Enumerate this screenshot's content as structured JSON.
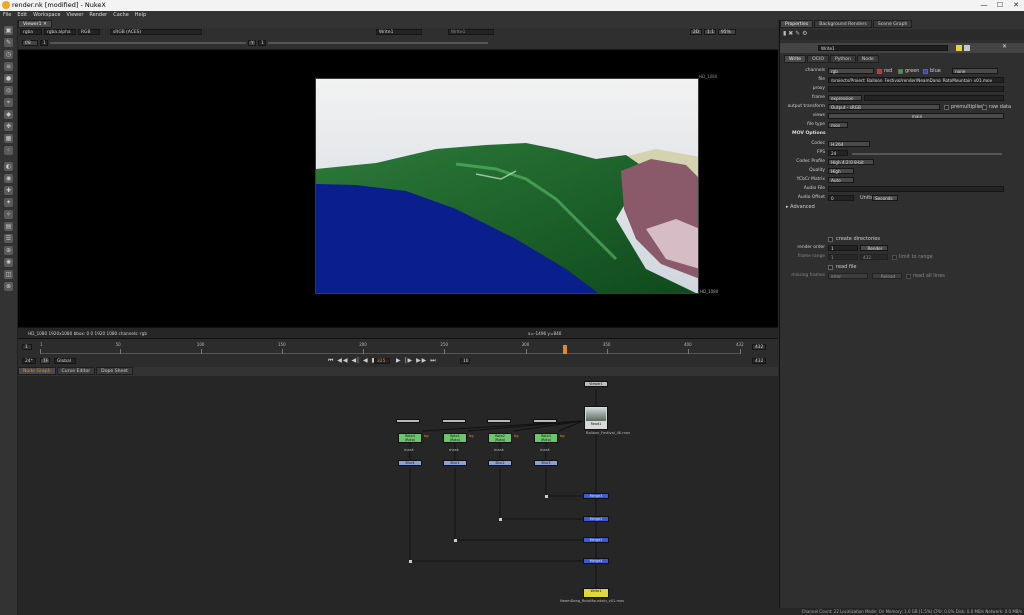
{
  "window": {
    "title": "render.nk [modified] - NukeX",
    "min": "—",
    "max": "☐",
    "close": "✕"
  },
  "menu": [
    "File",
    "Edit",
    "Workspace",
    "Viewer",
    "Render",
    "Cache",
    "Help"
  ],
  "viewer": {
    "tab": "Viewer1",
    "channels": "rgba",
    "alpha": "rgba.alpha",
    "colorspace_label": "RGB",
    "y_label": "sRGB (ACES)",
    "input_a": "Write1",
    "input_b": "Write1",
    "gain_label": "f/8",
    "gain_value": "1",
    "gamma_label": "Y",
    "gamma_value": "1",
    "frame_mode": "2D",
    "fps_ratio": "1:1",
    "zoom": "95%",
    "format_top": "HD_1080",
    "format_bottom": "HD_1080",
    "info_left": "HD_1080 1920x1080  bbox: 0 0 1920 1080 channels: rgb",
    "info_right": "x=-1496 y=840"
  },
  "timeline": {
    "start": "1",
    "end": "432",
    "end2": "432",
    "ticks": [
      "1",
      "50",
      "100",
      "150",
      "200",
      "250",
      "300",
      "350",
      "400",
      "432"
    ],
    "current_frame": "325",
    "current_fraction": 0.75,
    "fps": "24*",
    "tf": "TF",
    "global": "Global",
    "step": "10"
  },
  "nodegraph_tabs": [
    "Node Graph",
    "Curve Editor",
    "Dope Sheet"
  ],
  "nodes": {
    "viewer": "Viewer1",
    "read": "Read1",
    "read_sub": "Balloon_Festival_4K.mov",
    "write": "Write1",
    "write_sub": "NeamDang_RotoMountain_v01.mov",
    "rotos": [
      {
        "name": "Roto4",
        "sub": "(Roto)",
        "blur": "Blur4"
      },
      {
        "name": "Roto1",
        "sub": "(Roto)",
        "blur": "Blur1"
      },
      {
        "name": "Roto2",
        "sub": "(Roto)",
        "blur": "Blur2"
      },
      {
        "name": "Roto3",
        "sub": "(Roto)",
        "blur": "Blur3"
      }
    ],
    "bg_label": "bg",
    "mask_label": "mask",
    "merges": [
      "Merge3",
      "Merge2",
      "Merge1",
      "Merge4"
    ]
  },
  "panel": {
    "tabs": [
      "Properties",
      "Background Renders",
      "Scene Graph"
    ],
    "node_name": "Write1",
    "subtabs": [
      "Write",
      "OCIO",
      "Python",
      "Node"
    ],
    "channels_label": "channels",
    "channels_value": "rgb",
    "red": "red",
    "green": "green",
    "blue": "blue",
    "none": "none",
    "file_label": "file",
    "file_value": "/projects/Project_Balloon_Festival/render/NeamDang_RotoMountain_v01.mov",
    "proxy_label": "proxy",
    "frame_label": "frame",
    "frame_value": "expression",
    "output_transform_label": "output transform",
    "output_transform_value": "Output - sRGB",
    "premultiplied": "premultiplied",
    "raw_data": "raw data",
    "views_label": "views",
    "views_value": "main",
    "file_type_label": "file type",
    "file_type_value": "mov",
    "mov_options": "MOV Options",
    "codec_label": "Codec",
    "codec_value": "H.264",
    "fps_label": "FPS",
    "fps_value": "24",
    "codec_profile_label": "Codec Profile",
    "codec_profile_value": "High 4:2:0 8-bit",
    "quality_label": "Quality",
    "quality_value": "High",
    "ycbcr_label": "YCbCr Matrix",
    "ycbcr_value": "Auto",
    "audio_file_label": "Audio File",
    "audio_offset_label": "Audio Offset",
    "audio_offset_value": "0",
    "units_label": "Units",
    "units_value": "Seconds",
    "advanced": "Advanced",
    "create_dirs": "create directories",
    "render_order_label": "render order",
    "render_order_value": "1",
    "render_button": "Render",
    "frame_range_label": "frame range",
    "frame_range_start": "1",
    "frame_range_end": "432",
    "limit_to_range": "limit to range",
    "read_file": "read file",
    "missing_frames_label": "missing frames",
    "missing_frames_value": "error",
    "reload_button": "Reload",
    "read_all_lines": "read all lines"
  },
  "status": "Channel Count: 22  Localization Mode: On  Memory: 1.0 GB (1.5%)  CPU: 0.0%  Disk: 0.0 MB/s  Network: 0.0 MB/s",
  "colors": {
    "roto": "#6cc46c",
    "blur": "#8aa0d8",
    "merge": "#3b5bd1",
    "write": "#e3d63a",
    "accent": "#e08a2a"
  }
}
